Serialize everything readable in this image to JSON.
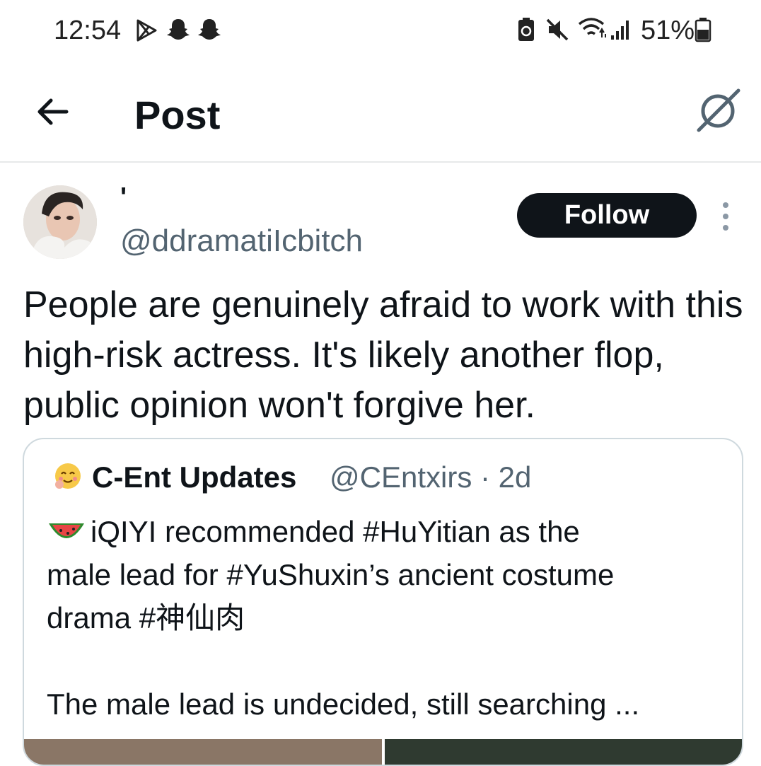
{
  "status_bar": {
    "time": "12:54",
    "battery_percent": "51%",
    "icons": [
      "play-store-icon",
      "snapchat-icon",
      "snapchat-icon",
      "battery-saver-icon",
      "mute-icon",
      "wifi-icon",
      "signal-icon",
      "battery-icon"
    ]
  },
  "header": {
    "back_icon": "arrow-left-icon",
    "title": "Post",
    "right_icon": "grok-icon"
  },
  "post": {
    "author": {
      "display_name": "'",
      "handle": "@ddramatiIcbitch"
    },
    "follow_label": "Follow",
    "more_icon": "more-vertical-icon",
    "text": "People are genuinely afraid to work with this high-risk actress. It's likely another flop, public opinion won't forgive her."
  },
  "quoted_post": {
    "author_name": "C-Ent Updates",
    "author_handle_time": "@CEntxirs · 2d",
    "emoji_avatar": "🥰",
    "lead_emoji": "🍉",
    "lines": [
      "iQIYI recommended #HuYitian as the",
      "male lead for #YuShuxin’s ancient costume",
      "drama #神仙肉",
      "",
      "The male lead is undecided, still searching ..."
    ]
  },
  "colors": {
    "text_primary": "#0f1419",
    "text_secondary": "#536471",
    "border": "#cfd9de",
    "follow_bg": "#0f1419"
  }
}
